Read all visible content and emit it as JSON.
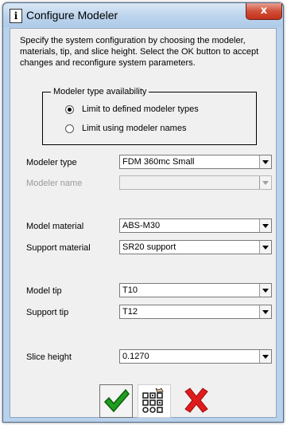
{
  "window": {
    "title": "Configure Modeler",
    "close_glyph": "x",
    "icon_glyph": "i"
  },
  "description": "Specify the system configuration by choosing the modeler, materials, tip, and slice height.  Select the OK button to accept changes and reconfigure system parameters.",
  "modeler_type_availability": {
    "label": "Modeler type availability",
    "options": [
      {
        "label": "Limit to defined modeler types",
        "selected": true
      },
      {
        "label": "Limit using modeler names",
        "selected": false
      }
    ]
  },
  "fields": {
    "modeler_type": {
      "label": "Modeler type",
      "value": "FDM 360mc Small"
    },
    "modeler_name": {
      "label": "Modeler name",
      "value": ""
    },
    "model_material": {
      "label": "Model material",
      "value": "ABS-M30"
    },
    "support_material": {
      "label": "Support material",
      "value": "SR20 support"
    },
    "model_tip": {
      "label": "Model tip",
      "value": "T10"
    },
    "support_tip": {
      "label": "Support tip",
      "value": "T12"
    },
    "slice_height": {
      "label": "Slice height",
      "value": "0.1270"
    }
  },
  "buttons": {
    "ok_icon": "green-checkmark-icon",
    "configure_icon": "configure-grid-icon",
    "cancel_icon": "red-x-icon"
  },
  "colors": {
    "ok_green": "#1f9e1f",
    "cancel_red": "#e01b1b",
    "close_red": "#c4311b"
  }
}
